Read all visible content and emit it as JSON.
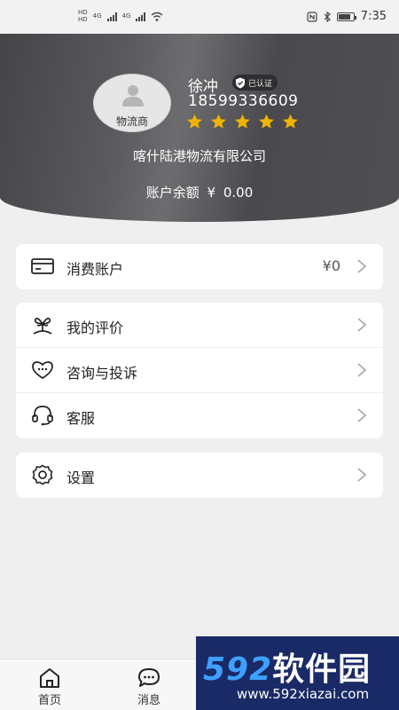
{
  "status_bar": {
    "sim1": "HD",
    "sim2": "HD",
    "net1": "4G",
    "net2": "4G",
    "time": "7:35"
  },
  "profile": {
    "avatar_tag": "物流商",
    "name": "徐冲",
    "verified_label": "已认证",
    "phone": "18599336609",
    "rating": 5,
    "rating_color": "#f0b400",
    "company": "喀什陆港物流有限公司",
    "balance_label": "账户余额",
    "currency": "¥",
    "balance_value": "0.00"
  },
  "menu": {
    "account": {
      "label": "消费账户",
      "value": "¥0",
      "icon": "wallet-icon"
    },
    "reviews": {
      "label": "我的评价",
      "icon": "flower-icon"
    },
    "complaints": {
      "label": "咨询与投诉",
      "icon": "complaint-icon"
    },
    "service": {
      "label": "客服",
      "icon": "headset-icon"
    },
    "settings": {
      "label": "设置",
      "icon": "gear-icon"
    }
  },
  "bottom_nav": [
    {
      "label": "首页",
      "icon": "home-icon"
    },
    {
      "label": "消息",
      "icon": "message-icon"
    }
  ],
  "watermark": {
    "brand_digits": "592",
    "brand_text": "软件园",
    "url": "www.592xiazai.com"
  }
}
